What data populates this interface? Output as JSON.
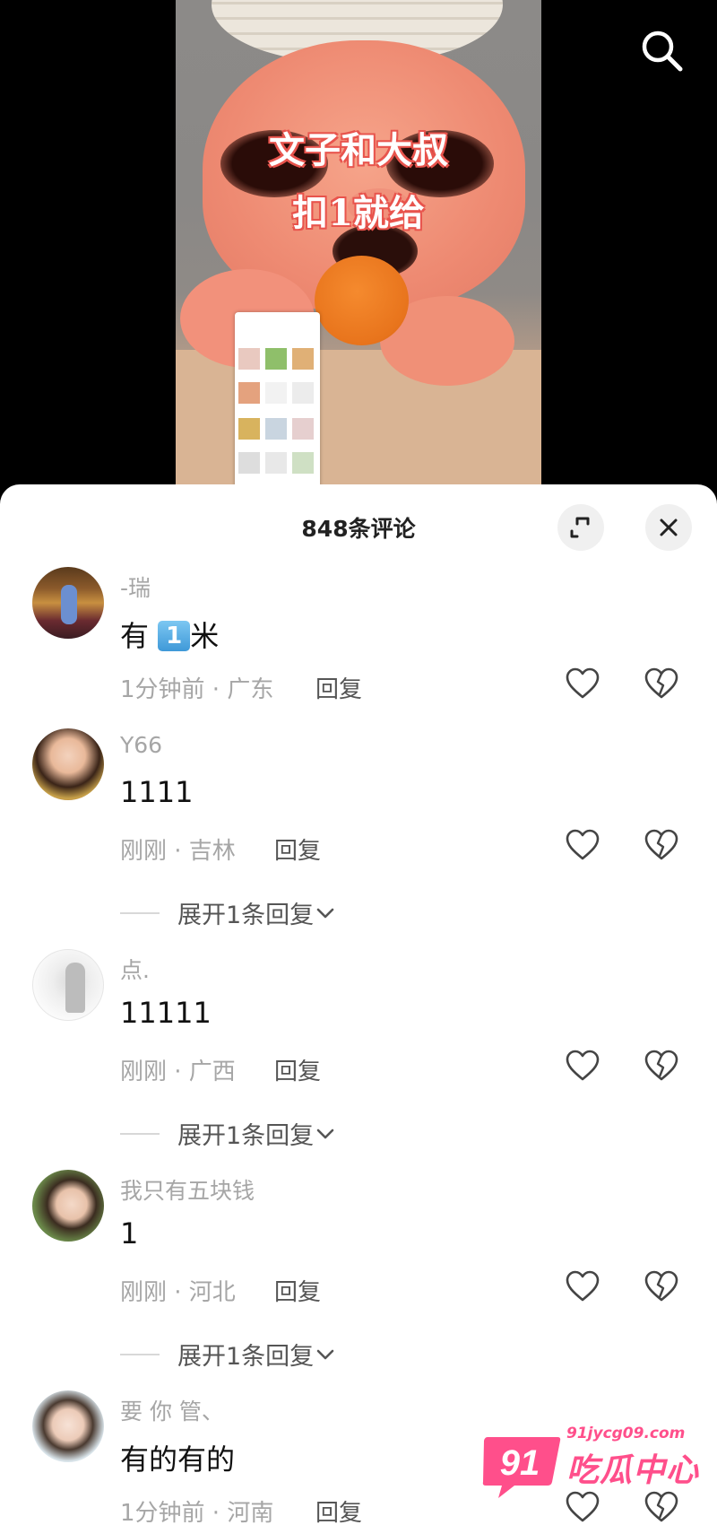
{
  "video": {
    "overlay_line1": "文子和大叔",
    "overlay_line2": "扣1就给"
  },
  "comments_panel": {
    "title": "848条评论"
  },
  "comments": [
    {
      "username": "-瑞",
      "text_prefix": "有 ",
      "badge": "1",
      "text_suffix": "米",
      "time_location": "1分钟前 · 广东",
      "reply_label": "回复"
    },
    {
      "username": "Y66",
      "text": "1111",
      "time_location": "刚刚 · 吉林",
      "reply_label": "回复",
      "expand_label": "展开1条回复"
    },
    {
      "username": "点.",
      "text": "11111",
      "time_location": "刚刚 · 广西",
      "reply_label": "回复",
      "expand_label": "展开1条回复"
    },
    {
      "username": "我只有五块钱",
      "text": "1",
      "time_location": "刚刚 · 河北",
      "reply_label": "回复",
      "expand_label": "展开1条回复"
    },
    {
      "username": "要 你 管、",
      "text": "有的有的",
      "time_location": "1分钟前 · 河南",
      "reply_label": "回复"
    }
  ],
  "watermark": {
    "number": "91",
    "url": "91jycg09.com",
    "title": "吃瓜中心"
  },
  "icons": [
    "search-icon",
    "expand-icon",
    "close-icon",
    "heart-icon",
    "broken-heart-icon",
    "chevron-down-icon"
  ],
  "colors": {
    "watermark": "#ff4f8b",
    "overlay_outline": "#e8554e"
  }
}
